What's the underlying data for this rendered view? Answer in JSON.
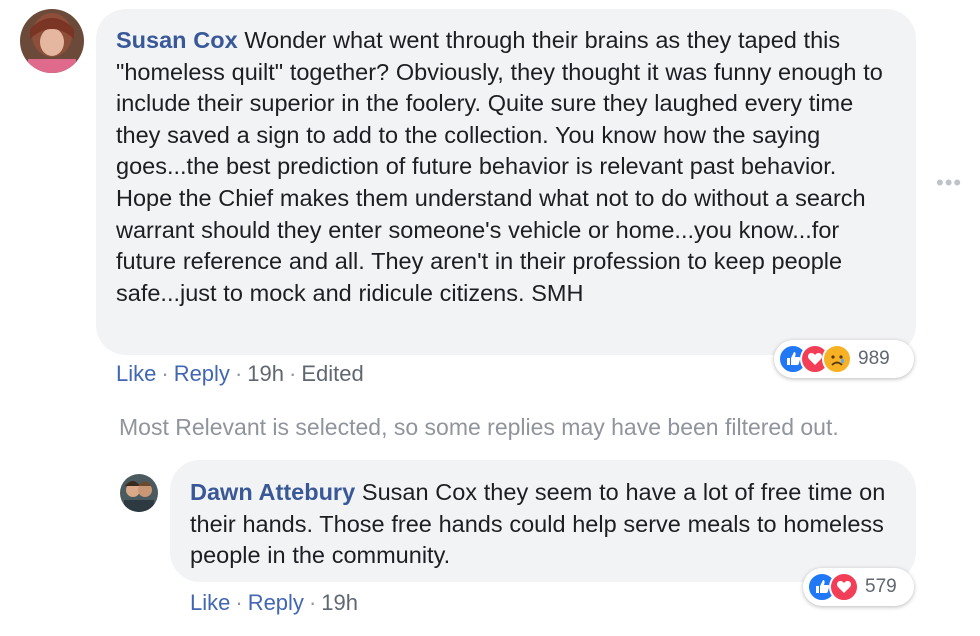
{
  "comment": {
    "author": "Susan Cox",
    "text": "Wonder what went through their brains as they taped this \"homeless quilt\" together? Obviously, they thought it was funny enough to include their superior in the foolery. Quite sure they laughed every time they saved a sign to add to the collection. You know how the saying goes...the best prediction of future behavior is relevant past behavior. Hope the Chief makes them understand what not to do without a search warrant should they enter someone's vehicle or home...you know...for future reference and all. They aren't in their profession to keep people safe...just to mock and ridicule citizens. SMH",
    "actions": {
      "like": "Like",
      "reply": "Reply",
      "time": "19h",
      "edited": "Edited",
      "sep": "·"
    },
    "reactions": {
      "icons": [
        "like-icon",
        "love-icon",
        "sad-icon"
      ],
      "count": "989"
    },
    "more_icon": "more-options-icon"
  },
  "filter_notice": "Most Relevant is selected, so some replies may have been filtered out.",
  "reply": {
    "author": "Dawn Attebury",
    "text": "Susan Cox they seem to have a lot of free time on their hands. Those free hands could help serve meals to homeless people in the community.",
    "actions": {
      "like": "Like",
      "reply": "Reply",
      "time": "19h",
      "sep": "·"
    },
    "reactions": {
      "icons": [
        "like-icon",
        "love-icon"
      ],
      "count": "579"
    }
  },
  "colors": {
    "link": "#385898",
    "action": "#4267b2",
    "bubble": "#f2f3f5",
    "muted": "#90949c",
    "like": "#2078f4",
    "love": "#f33e58",
    "sad": "#f7b125"
  }
}
